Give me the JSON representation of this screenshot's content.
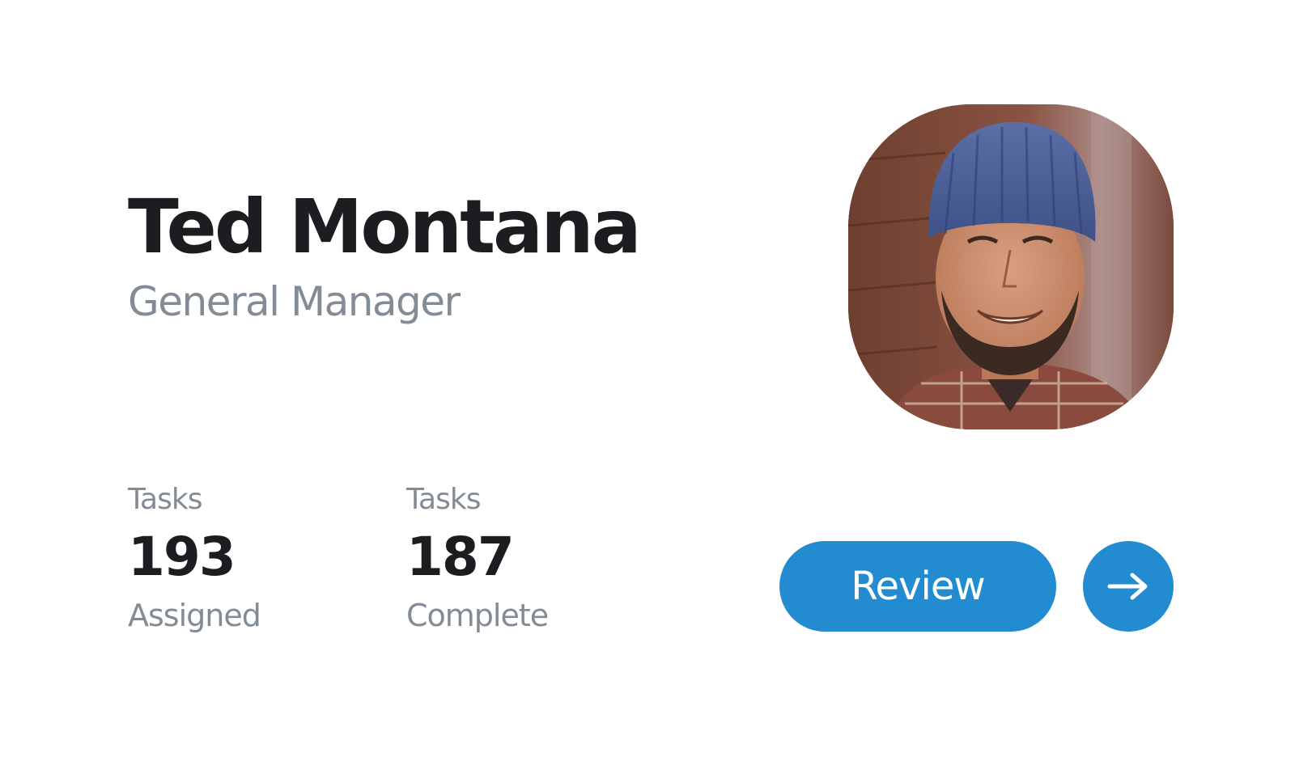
{
  "profile": {
    "name": "Ted Montana",
    "role": "General Manager",
    "photo_icon": "person-photo"
  },
  "stats": [
    {
      "label": "Tasks",
      "value": "193",
      "caption": "Assigned"
    },
    {
      "label": "Tasks",
      "value": "187",
      "caption": "Complete"
    }
  ],
  "actions": {
    "review_label": "Review",
    "arrow_icon": "arrow-right-icon"
  },
  "colors": {
    "accent": "#238bcf",
    "name_text": "#1b1d20",
    "muted_text": "#838b95",
    "background": "#ffffff"
  }
}
